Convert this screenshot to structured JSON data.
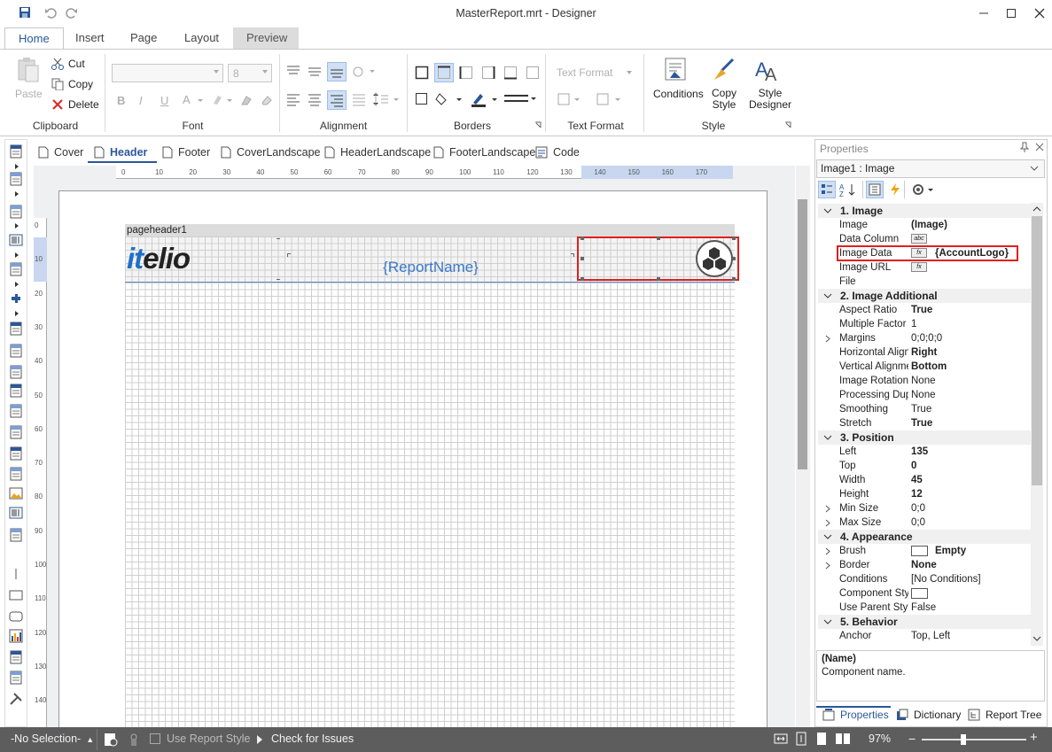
{
  "window": {
    "title": "MasterReport.mrt - Designer"
  },
  "ribbon_tabs": [
    "Home",
    "Insert",
    "Page",
    "Layout",
    "Preview"
  ],
  "clipboard": {
    "paste": "Paste",
    "cut": "Cut",
    "copy": "Copy",
    "delete": "Delete",
    "label": "Clipboard"
  },
  "font": {
    "size": "8",
    "label": "Font",
    "bold": "B",
    "italic": "I",
    "underline": "U"
  },
  "alignment": {
    "label": "Alignment"
  },
  "borders": {
    "label": "Borders"
  },
  "text_format": {
    "combo": "Text Format",
    "label": "Text Format"
  },
  "style": {
    "conditions": "Conditions",
    "copy_style_1": "Copy",
    "copy_style_2": "Style",
    "style_designer_1": "Style",
    "style_designer_2": "Designer",
    "label": "Style"
  },
  "page_tabs": [
    "Cover",
    "Header",
    "Footer",
    "CoverLandscape",
    "HeaderLandscape",
    "FooterLandscape",
    "Code"
  ],
  "ruler_top": [
    "0",
    "10",
    "20",
    "30",
    "40",
    "50",
    "60",
    "70",
    "80",
    "90",
    "100",
    "110",
    "120",
    "130",
    "140",
    "150",
    "160",
    "170"
  ],
  "ruler_left": [
    "0",
    "10",
    "20",
    "30",
    "40",
    "50",
    "60",
    "70",
    "80",
    "90",
    "100",
    "110",
    "120",
    "130",
    "140"
  ],
  "report": {
    "band_name": "pageheader1",
    "logo_prefix": "it",
    "logo_suffix": "elio",
    "report_name": "{ReportName}"
  },
  "properties": {
    "title": "Properties",
    "selected": "Image1 : Image",
    "rows": [
      {
        "cat": "1. Image"
      },
      {
        "name": "Image",
        "value": "(Image)",
        "bold": true
      },
      {
        "name": "Data Column",
        "icon": "abc"
      },
      {
        "name": "Image Data",
        "icon": "fx",
        "value": "{AccountLogo}",
        "bold": true,
        "highlight": true
      },
      {
        "name": "Image URL",
        "icon": "fx"
      },
      {
        "name": "File"
      },
      {
        "cat": "2. Image  Additional"
      },
      {
        "name": "Aspect Ratio",
        "value": "True",
        "bold": true
      },
      {
        "name": "Multiple Factor",
        "value": "1"
      },
      {
        "name": "Margins",
        "value": "0;0;0;0",
        "expand": true
      },
      {
        "name": "Horizontal Alignm",
        "value": "Right",
        "bold": true
      },
      {
        "name": "Vertical Alignmen",
        "value": "Bottom",
        "bold": true
      },
      {
        "name": "Image Rotation",
        "value": "None"
      },
      {
        "name": "Processing Dupli",
        "value": "None"
      },
      {
        "name": "Smoothing",
        "value": "True"
      },
      {
        "name": "Stretch",
        "value": "True",
        "bold": true
      },
      {
        "cat": "3. Position"
      },
      {
        "name": "Left",
        "value": "135",
        "bold": true
      },
      {
        "name": "Top",
        "value": "0",
        "bold": true
      },
      {
        "name": "Width",
        "value": "45",
        "bold": true
      },
      {
        "name": "Height",
        "value": "12",
        "bold": true
      },
      {
        "name": "Min Size",
        "value": "0;0",
        "expand": true
      },
      {
        "name": "Max Size",
        "value": "0;0",
        "expand": true
      },
      {
        "cat": "4. Appearance"
      },
      {
        "name": "Brush",
        "value": "Empty",
        "bold": true,
        "swatch": true,
        "expand": true
      },
      {
        "name": "Border",
        "value": "None",
        "bold": true,
        "expand": true
      },
      {
        "name": "Conditions",
        "value": "[No Conditions]"
      },
      {
        "name": "Component Style",
        "swatch": true
      },
      {
        "name": "Use Parent Style",
        "value": "False"
      },
      {
        "cat": "5. Behavior"
      },
      {
        "name": "Anchor",
        "value": "Top, Left"
      }
    ],
    "desc_title": "(Name)",
    "desc_text": "Component name.",
    "bottom_tabs": [
      "Properties",
      "Dictionary",
      "Report Tree"
    ]
  },
  "status": {
    "selection": "-No Selection-",
    "use_report_style": "Use Report Style",
    "check_issues": "Check for Issues",
    "zoom": "97%"
  }
}
